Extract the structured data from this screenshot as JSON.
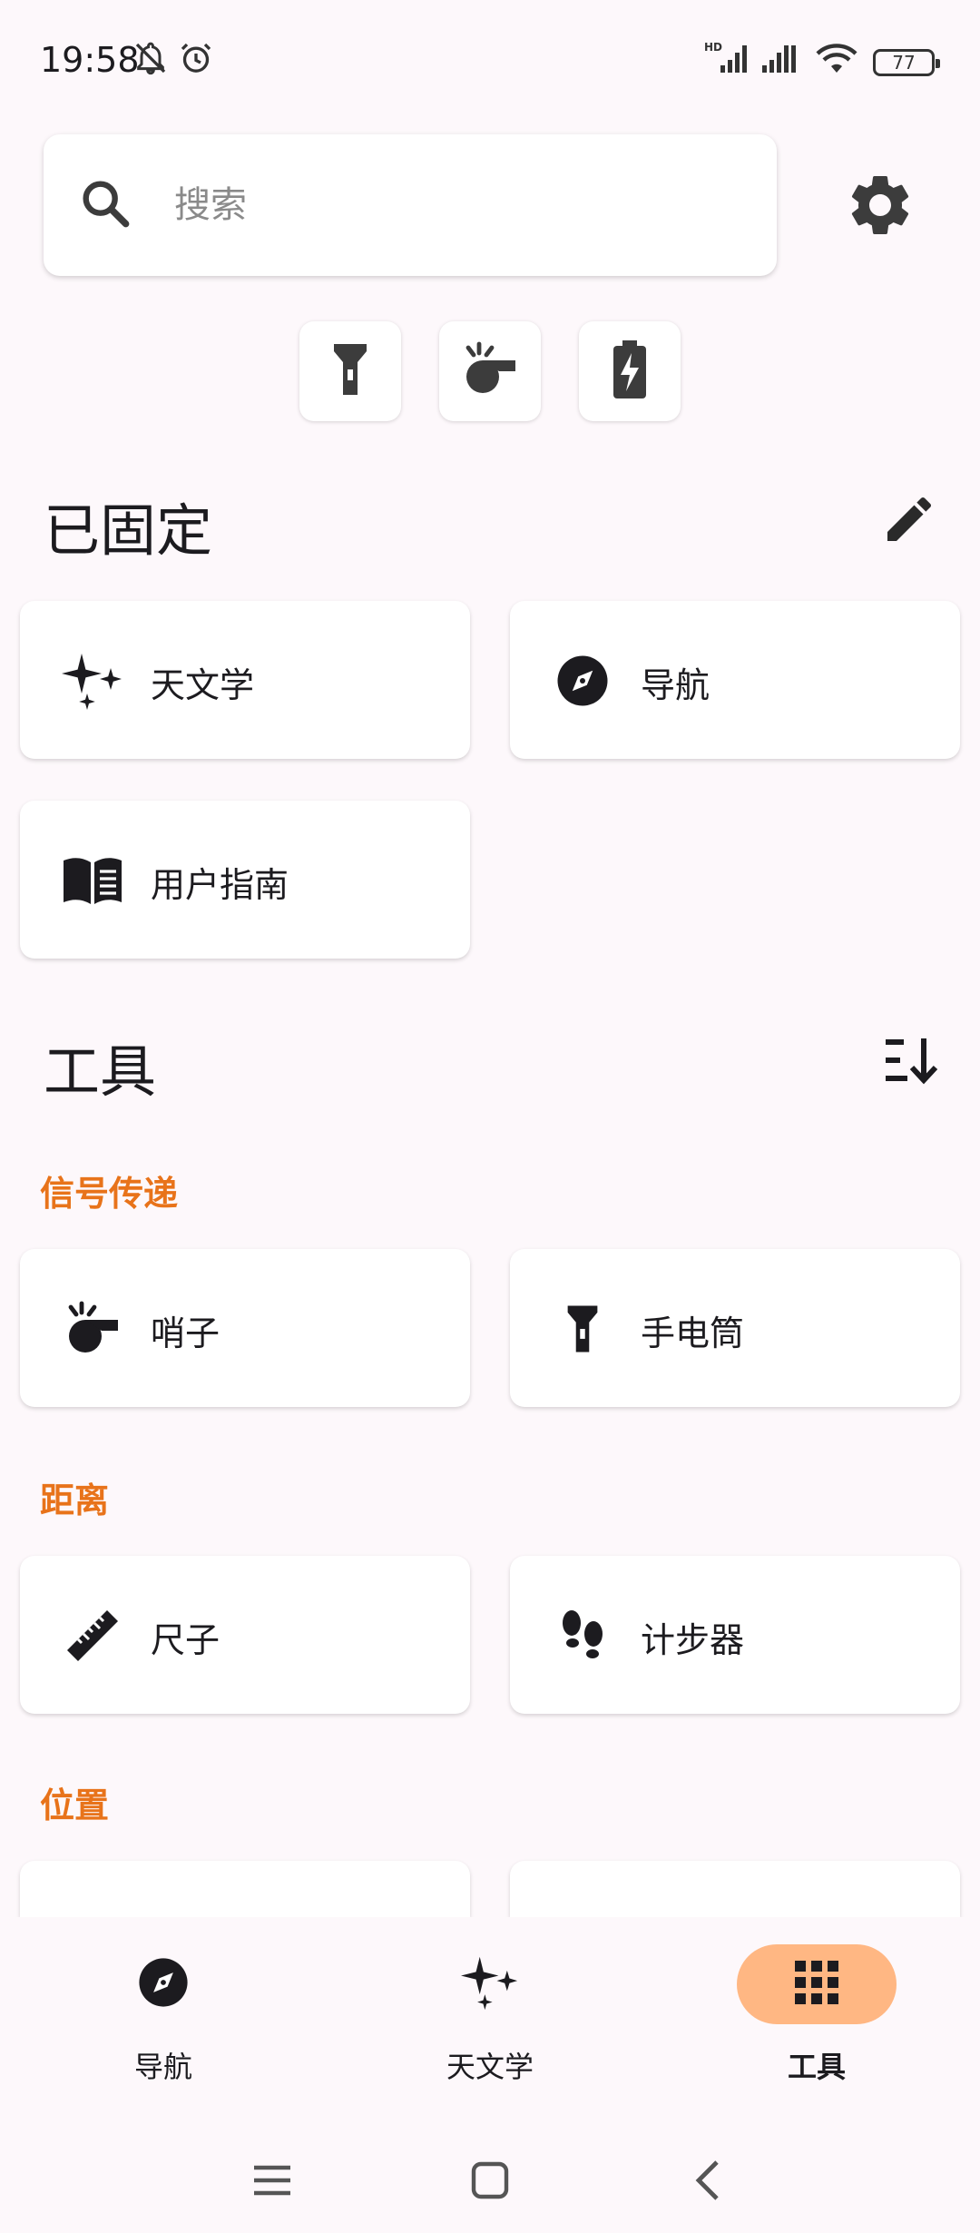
{
  "status_bar": {
    "time": "19:58",
    "battery": "77",
    "network_label": "HD"
  },
  "search": {
    "placeholder": "搜索",
    "value": ""
  },
  "quick_actions": [
    {
      "icon": "flashlight-icon"
    },
    {
      "icon": "whistle-icon"
    },
    {
      "icon": "battery-bolt-icon"
    }
  ],
  "pinned": {
    "title": "已固定",
    "items": [
      {
        "label": "天文学",
        "icon": "sparkle-icon"
      },
      {
        "label": "导航",
        "icon": "compass-icon"
      },
      {
        "label": "用户指南",
        "icon": "book-icon"
      }
    ]
  },
  "tools": {
    "title": "工具",
    "categories": [
      {
        "label": "信号传递",
        "items": [
          {
            "label": "哨子",
            "icon": "whistle-icon"
          },
          {
            "label": "手电筒",
            "icon": "flashlight-icon"
          }
        ]
      },
      {
        "label": "距离",
        "items": [
          {
            "label": "尺子",
            "icon": "ruler-icon"
          },
          {
            "label": "计步器",
            "icon": "footsteps-icon"
          }
        ]
      },
      {
        "label": "位置",
        "items": []
      }
    ]
  },
  "bottom_nav": [
    {
      "label": "导航",
      "icon": "compass-icon",
      "active": false
    },
    {
      "label": "天文学",
      "icon": "sparkle-icon",
      "active": false
    },
    {
      "label": "工具",
      "icon": "grid-icon",
      "active": true
    }
  ],
  "colors": {
    "accent": "#E8731A",
    "active_pill": "#FFB783",
    "background": "#FDF8FB"
  }
}
